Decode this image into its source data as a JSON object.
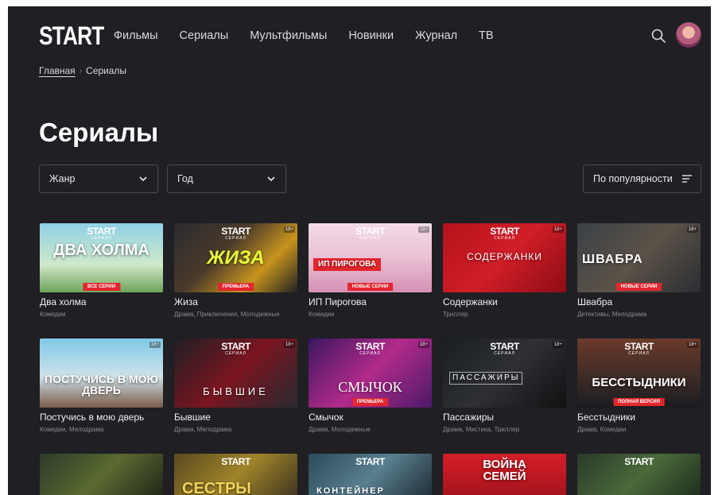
{
  "header": {
    "logo": "START",
    "nav": [
      "Фильмы",
      "Сериалы",
      "Мультфильмы",
      "Новинки",
      "Журнал",
      "ТВ"
    ]
  },
  "breadcrumb": {
    "home": "Главная",
    "current": "Сериалы"
  },
  "page_title": "Сериалы",
  "filters": {
    "genre": "Жанр",
    "year": "Год",
    "sort": "По популярности"
  },
  "brand_sub": "СЕРИАЛ",
  "age": "18+",
  "cards": [
    {
      "title": "Два холма",
      "genres": "Комедии",
      "art": "ДВА ХОЛМА",
      "badge": "ВСЕ СЕРИИ"
    },
    {
      "title": "Жиза",
      "genres": "Драма, Приключения, Молодежные",
      "art": "ЖИЗА",
      "badge": "ПРЕМЬЕРА"
    },
    {
      "title": "ИП Пирогова",
      "genres": "Комедии",
      "art": "ИП ПИРОГОВА",
      "badge": "НОВЫЕ СЕРИИ"
    },
    {
      "title": "Содержанки",
      "genres": "Триллер",
      "art": "СОДЕРЖАНКИ",
      "badge": ""
    },
    {
      "title": "Швабра",
      "genres": "Детективы, Мелодрама",
      "art": "ШВАБРА",
      "badge": "НОВЫЕ СЕРИИ"
    },
    {
      "title": "Постучись в мою дверь",
      "genres": "Комедии, Мелодрама",
      "art": "ПОСТУЧИСЬ В МОЮ ДВЕРЬ",
      "badge": ""
    },
    {
      "title": "Бывшие",
      "genres": "Драма, Мелодрама",
      "art": "БЫВШИЕ",
      "badge": ""
    },
    {
      "title": "Смычок",
      "genres": "Драма, Молодежные",
      "art": "СМЫЧОК",
      "badge": "ПРЕМЬЕРА"
    },
    {
      "title": "Пассажиры",
      "genres": "Драма, Мистика, Триллер",
      "art": "ПАССАЖИРЫ",
      "badge": ""
    },
    {
      "title": "Бесстыдники",
      "genres": "Драма, Комедии",
      "art": "БЕССТЫДНИКИ",
      "badge": "ПОЛНАЯ ВЕРСИЯ"
    },
    {
      "title": "",
      "genres": "",
      "art": "",
      "badge": ""
    },
    {
      "title": "",
      "genres": "",
      "art": "СЕСТРЫ",
      "badge": ""
    },
    {
      "title": "",
      "genres": "",
      "art": "КОНТЕЙНЕР",
      "badge": ""
    },
    {
      "title": "",
      "genres": "",
      "art": "ВОЙНА СЕМЕЙ",
      "badge": ""
    },
    {
      "title": "",
      "genres": "",
      "art": "",
      "badge": ""
    }
  ],
  "colors": {
    "background": "#1f1f24",
    "accent": "#e3262f",
    "text_muted": "#8a8a92"
  }
}
